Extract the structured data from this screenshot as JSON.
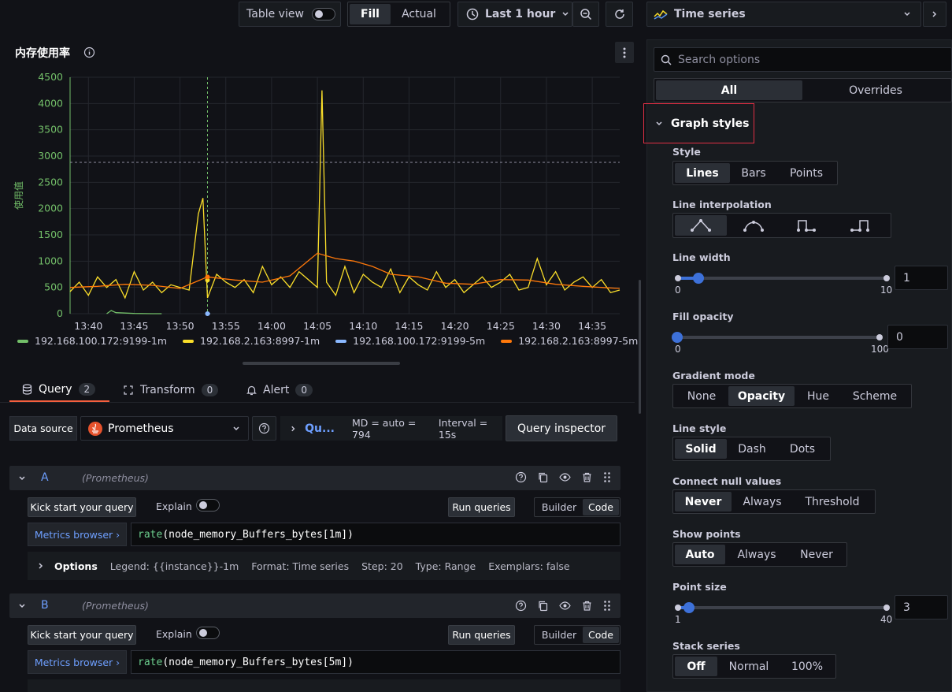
{
  "toolbar": {
    "table_view_label": "Table view",
    "fill_label": "Fill",
    "actual_label": "Actual",
    "time_range_label": "Last 1 hour",
    "viz_label": "Time series"
  },
  "panel": {
    "title": "内存使用率",
    "ylabel": "使用值"
  },
  "chart_data": {
    "type": "line",
    "title": "内存使用率",
    "ylabel": "使用值",
    "ylim": [
      0,
      4500
    ],
    "yticks": [
      "0",
      "500",
      "1000",
      "1500",
      "2000",
      "2500",
      "3000",
      "3500",
      "4000",
      "4500"
    ],
    "xticks": [
      "13:40",
      "13:45",
      "13:50",
      "13:55",
      "14:00",
      "14:05",
      "14:10",
      "14:15",
      "14:20",
      "14:25",
      "14:30",
      "14:35"
    ],
    "x_start": "13:38",
    "x_end": "14:38",
    "threshold_line": 2880,
    "series": [
      {
        "name": "192.168.100.172:9199-1m",
        "color": "#73bf69",
        "x": [
          "13:42",
          "13:42.5",
          "13:43",
          "13:45",
          "13:47",
          "13:48"
        ],
        "values": [
          0,
          60,
          20,
          5,
          0,
          0
        ]
      },
      {
        "name": "192.168.2.163:8997-1m",
        "color": "#fade2a",
        "x": [
          "13:38",
          "13:39",
          "13:40",
          "13:41",
          "13:42",
          "13:43",
          "13:44",
          "13:45",
          "13:46",
          "13:47",
          "13:48",
          "13:49",
          "13:50",
          "13:51",
          "13:52",
          "13:52.5",
          "13:53",
          "13:54",
          "13:55",
          "13:56",
          "13:57",
          "13:58",
          "13:59",
          "14:00",
          "14:01",
          "14:02",
          "14:03",
          "14:04",
          "14:05",
          "14:05.5",
          "14:06",
          "14:07",
          "14:08",
          "14:09",
          "14:10",
          "14:11",
          "14:12",
          "14:13",
          "14:14",
          "14:15",
          "14:16",
          "14:17",
          "14:18",
          "14:19",
          "14:20",
          "14:21",
          "14:22",
          "14:23",
          "14:24",
          "14:25",
          "14:26",
          "14:27",
          "14:28",
          "14:29",
          "14:30",
          "14:31",
          "14:32",
          "14:33",
          "14:34",
          "14:35",
          "14:36",
          "14:37",
          "14:38"
        ],
        "values": [
          420,
          600,
          350,
          700,
          500,
          650,
          300,
          800,
          450,
          600,
          400,
          550,
          500,
          450,
          1900,
          2200,
          300,
          750,
          600,
          500,
          650,
          400,
          900,
          550,
          700,
          500,
          800,
          650,
          500,
          4250,
          600,
          350,
          900,
          400,
          750,
          600,
          500,
          850,
          400,
          700,
          550,
          450,
          800,
          500,
          650,
          400,
          550,
          700,
          500,
          600,
          750,
          450,
          500,
          1050,
          550,
          800,
          450,
          600,
          700,
          500,
          650,
          400,
          450
        ]
      },
      {
        "name": "192.168.100.172:9199-5m",
        "color": "#8ab8ff",
        "x": [
          "13:53",
          "13:53.3"
        ],
        "values": [
          0,
          0
        ]
      },
      {
        "name": "192.168.2.163:8997-5m",
        "color": "#ff780a",
        "x": [
          "13:38",
          "13:41",
          "13:44",
          "13:47",
          "13:50",
          "13:53",
          "13:56",
          "13:59",
          "14:02",
          "14:05",
          "14:07",
          "14:09",
          "14:11",
          "14:13",
          "14:16",
          "14:19",
          "14:22",
          "14:25",
          "14:28",
          "14:31",
          "14:34",
          "14:38"
        ],
        "values": [
          500,
          520,
          560,
          540,
          480,
          700,
          640,
          600,
          720,
          1150,
          1050,
          1000,
          900,
          750,
          700,
          580,
          560,
          650,
          640,
          560,
          520,
          480
        ]
      }
    ]
  },
  "legend": [
    {
      "name": "192.168.100.172:9199-1m",
      "color": "#73bf69"
    },
    {
      "name": "192.168.2.163:8997-1m",
      "color": "#fade2a"
    },
    {
      "name": "192.168.100.172:9199-5m",
      "color": "#8ab8ff"
    },
    {
      "name": "192.168.2.163:8997-5m",
      "color": "#ff780a"
    }
  ],
  "tabs": {
    "query": "Query",
    "query_count": "2",
    "transform": "Transform",
    "transform_count": "0",
    "alert": "Alert",
    "alert_count": "0"
  },
  "datasource": {
    "label": "Data source",
    "value": "Prometheus",
    "query_options": "Qu...",
    "md": "MD = auto = 794",
    "interval": "Interval = 15s",
    "inspector": "Query inspector"
  },
  "queries": [
    {
      "ref": "A",
      "ds": "(Prometheus)",
      "kick_start": "Kick start your query",
      "explain": "Explain",
      "run": "Run queries",
      "builder": "Builder",
      "code": "Code",
      "metrics_browser": "Metrics browser ›",
      "fn": "rate",
      "expr_rest": "(node_memory_Buffers_bytes[1m])",
      "options_label": "Options",
      "legend": "Legend: {{instance}}-1m",
      "format": "Format: Time series",
      "step": "Step: 20",
      "type": "Type: Range",
      "exemplars": "Exemplars: false"
    },
    {
      "ref": "B",
      "ds": "(Prometheus)",
      "kick_start": "Kick start your query",
      "explain": "Explain",
      "run": "Run queries",
      "builder": "Builder",
      "code": "Code",
      "metrics_browser": "Metrics browser ›",
      "fn": "rate",
      "expr_rest": "(node_memory_Buffers_bytes[5m])"
    }
  ],
  "options_pane": {
    "search_placeholder": "Search options",
    "all_tab": "All",
    "overrides_tab": "Overrides",
    "section_title": "Graph styles",
    "style": {
      "label": "Style",
      "options": [
        "Lines",
        "Bars",
        "Points"
      ],
      "selected": "Lines"
    },
    "line_interpolation": {
      "label": "Line interpolation"
    },
    "line_width": {
      "label": "Line width",
      "min": "0",
      "max": "10",
      "value": "1",
      "fraction": 0.1
    },
    "fill_opacity": {
      "label": "Fill opacity",
      "min": "0",
      "max": "100",
      "value": "0",
      "fraction": 0
    },
    "gradient_mode": {
      "label": "Gradient mode",
      "options": [
        "None",
        "Opacity",
        "Hue",
        "Scheme"
      ],
      "selected": "Opacity"
    },
    "line_style": {
      "label": "Line style",
      "options": [
        "Solid",
        "Dash",
        "Dots"
      ],
      "selected": "Solid"
    },
    "connect_null": {
      "label": "Connect null values",
      "options": [
        "Never",
        "Always",
        "Threshold"
      ],
      "selected": "Never"
    },
    "show_points": {
      "label": "Show points",
      "options": [
        "Auto",
        "Always",
        "Never"
      ],
      "selected": "Auto"
    },
    "point_size": {
      "label": "Point size",
      "min": "1",
      "max": "40",
      "value": "3",
      "fraction": 0.05
    },
    "stack_series": {
      "label": "Stack series",
      "options": [
        "Off",
        "Normal",
        "100%"
      ],
      "selected": "Off"
    }
  }
}
